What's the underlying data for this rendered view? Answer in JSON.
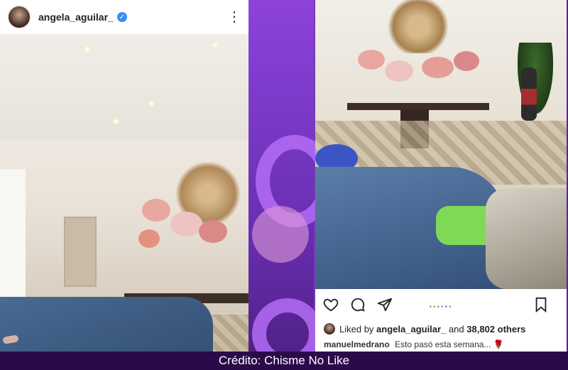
{
  "left_post": {
    "username": "angela_aguilar_",
    "verified_icon": "verified-check-icon",
    "more_icon": "more-options-icon"
  },
  "right_post": {
    "likes_prefix": "Liked by",
    "likes_user": "angela_aguilar_",
    "likes_connector": "and",
    "likes_count": "38,802 others",
    "caption_user": "manuelmedrano",
    "caption_text": "Esto pasó esta semana...",
    "caption_emoji": "🌹",
    "carousel_total": 6,
    "carousel_active": 5,
    "icons": [
      "heart-icon",
      "comment-icon",
      "share-icon",
      "bookmark-icon"
    ]
  },
  "credit": {
    "text": "Crédito: Chisme No Like"
  },
  "colors": {
    "background": "#5b2a86",
    "verified": "#3a8ef5",
    "credit_bar": "#2b0a4a"
  }
}
